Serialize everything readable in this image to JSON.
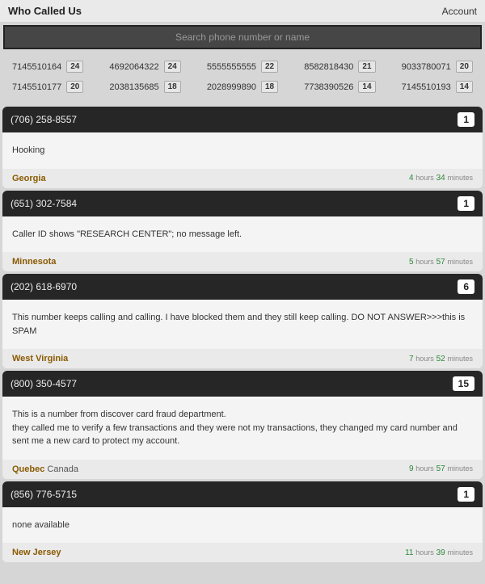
{
  "header": {
    "brand": "Who Called Us",
    "account_link": "Account"
  },
  "search": {
    "placeholder": "Search phone number or name"
  },
  "trending": [
    {
      "number": "7145510164",
      "count": "24"
    },
    {
      "number": "4692064322",
      "count": "24"
    },
    {
      "number": "5555555555",
      "count": "22"
    },
    {
      "number": "8582818430",
      "count": "21"
    },
    {
      "number": "9033780071",
      "count": "20"
    },
    {
      "number": "7145510177",
      "count": "20"
    },
    {
      "number": "2038135685",
      "count": "18"
    },
    {
      "number": "2028999890",
      "count": "18"
    },
    {
      "number": "7738390526",
      "count": "14"
    },
    {
      "number": "7145510193",
      "count": "14"
    }
  ],
  "entries": [
    {
      "phone": "(706) 258-8557",
      "count": "1",
      "comment": "Hooking",
      "state": "Georgia",
      "country": "",
      "hours": "4",
      "minutes": "34"
    },
    {
      "phone": "(651) 302-7584",
      "count": "1",
      "comment": "Caller ID shows \"RESEARCH CENTER\"; no message left.",
      "state": "Minnesota",
      "country": "",
      "hours": "5",
      "minutes": "57"
    },
    {
      "phone": "(202) 618-6970",
      "count": "6",
      "comment": "This number keeps calling and calling. I have blocked them and they still keep calling. DO NOT ANSWER>>>this is SPAM",
      "state": "West Virginia",
      "country": "",
      "hours": "7",
      "minutes": "52"
    },
    {
      "phone": "(800) 350-4577",
      "count": "15",
      "comment": "This is a number from discover card fraud department.\nthey called me to verify a few transactions and they were not my transactions, they changed my card number and sent me a new card to protect my account.",
      "state": "Quebec",
      "country": "Canada",
      "hours": "9",
      "minutes": "57"
    },
    {
      "phone": "(856) 776-5715",
      "count": "1",
      "comment": "none available",
      "state": "New Jersey",
      "country": "",
      "hours": "11",
      "minutes": "39"
    }
  ],
  "labels": {
    "hours": "hours",
    "minutes": "minutes"
  }
}
